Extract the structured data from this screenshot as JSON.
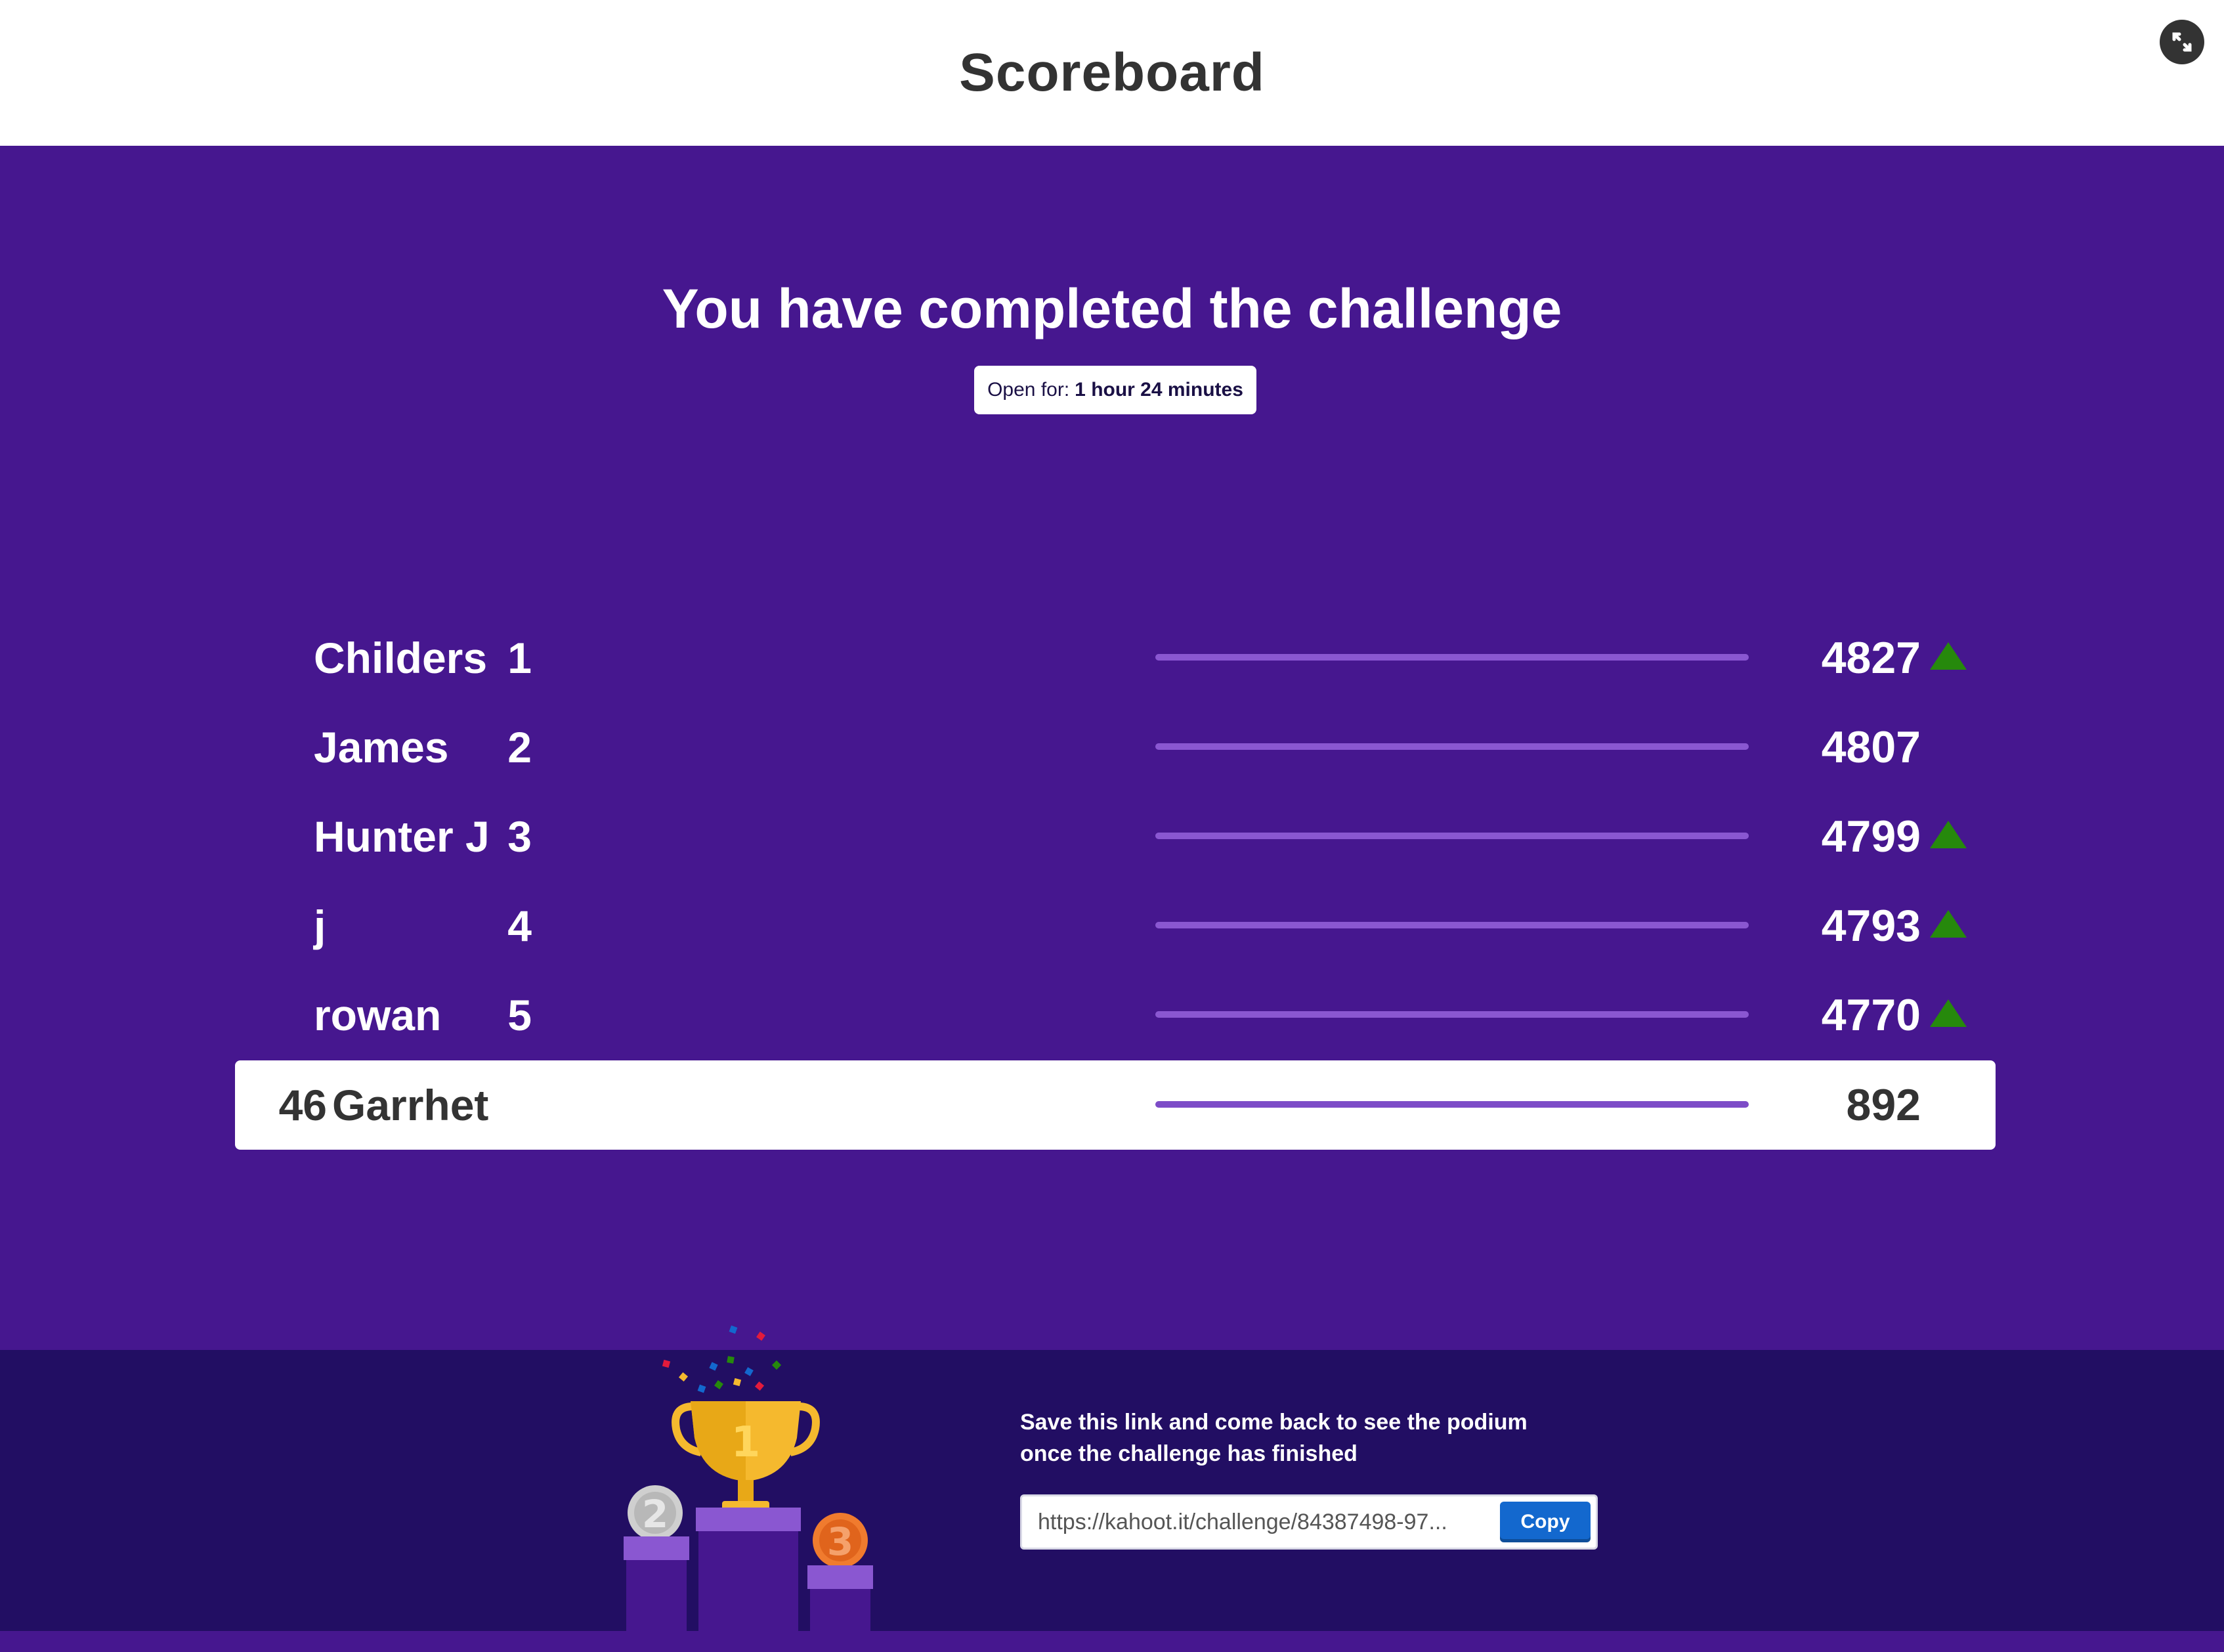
{
  "header": {
    "title": "Scoreboard",
    "fullscreen_icon": "expand-icon"
  },
  "challenge": {
    "headline": "You have completed the challenge",
    "open_for_label": "Open for:",
    "open_for_value": "1 hour 24 minutes"
  },
  "leaderboard": [
    {
      "rank": "1",
      "name": "Childers",
      "score": "4827",
      "trend": "up",
      "progress": 1.0
    },
    {
      "rank": "2",
      "name": "James",
      "score": "4807",
      "trend": "none",
      "progress": 1.0
    },
    {
      "rank": "3",
      "name": "Hunter J",
      "score": "4799",
      "trend": "up",
      "progress": 1.0
    },
    {
      "rank": "4",
      "name": "j",
      "score": "4793",
      "trend": "up",
      "progress": 1.0
    },
    {
      "rank": "5",
      "name": "rowan",
      "score": "4770",
      "trend": "up",
      "progress": 1.0
    }
  ],
  "current_player": {
    "rank": "46",
    "name": "Garrhet",
    "score": "892",
    "progress": 1.0
  },
  "footer": {
    "save_text_line1": "Save this link and come back to see the podium",
    "save_text_line2": "once the challenge has finished",
    "link_value": "https://kahoot.it/challenge/84387498-97...",
    "copy_label": "Copy",
    "podium_places": [
      "1",
      "2",
      "3"
    ]
  },
  "colors": {
    "background": "#46178f",
    "footer": "#220e63",
    "trend_up": "#26890c",
    "copy_button": "#1368ce",
    "gold": "#f5b92e",
    "silver": "#b8b8b8",
    "bronze": "#e0641c"
  }
}
